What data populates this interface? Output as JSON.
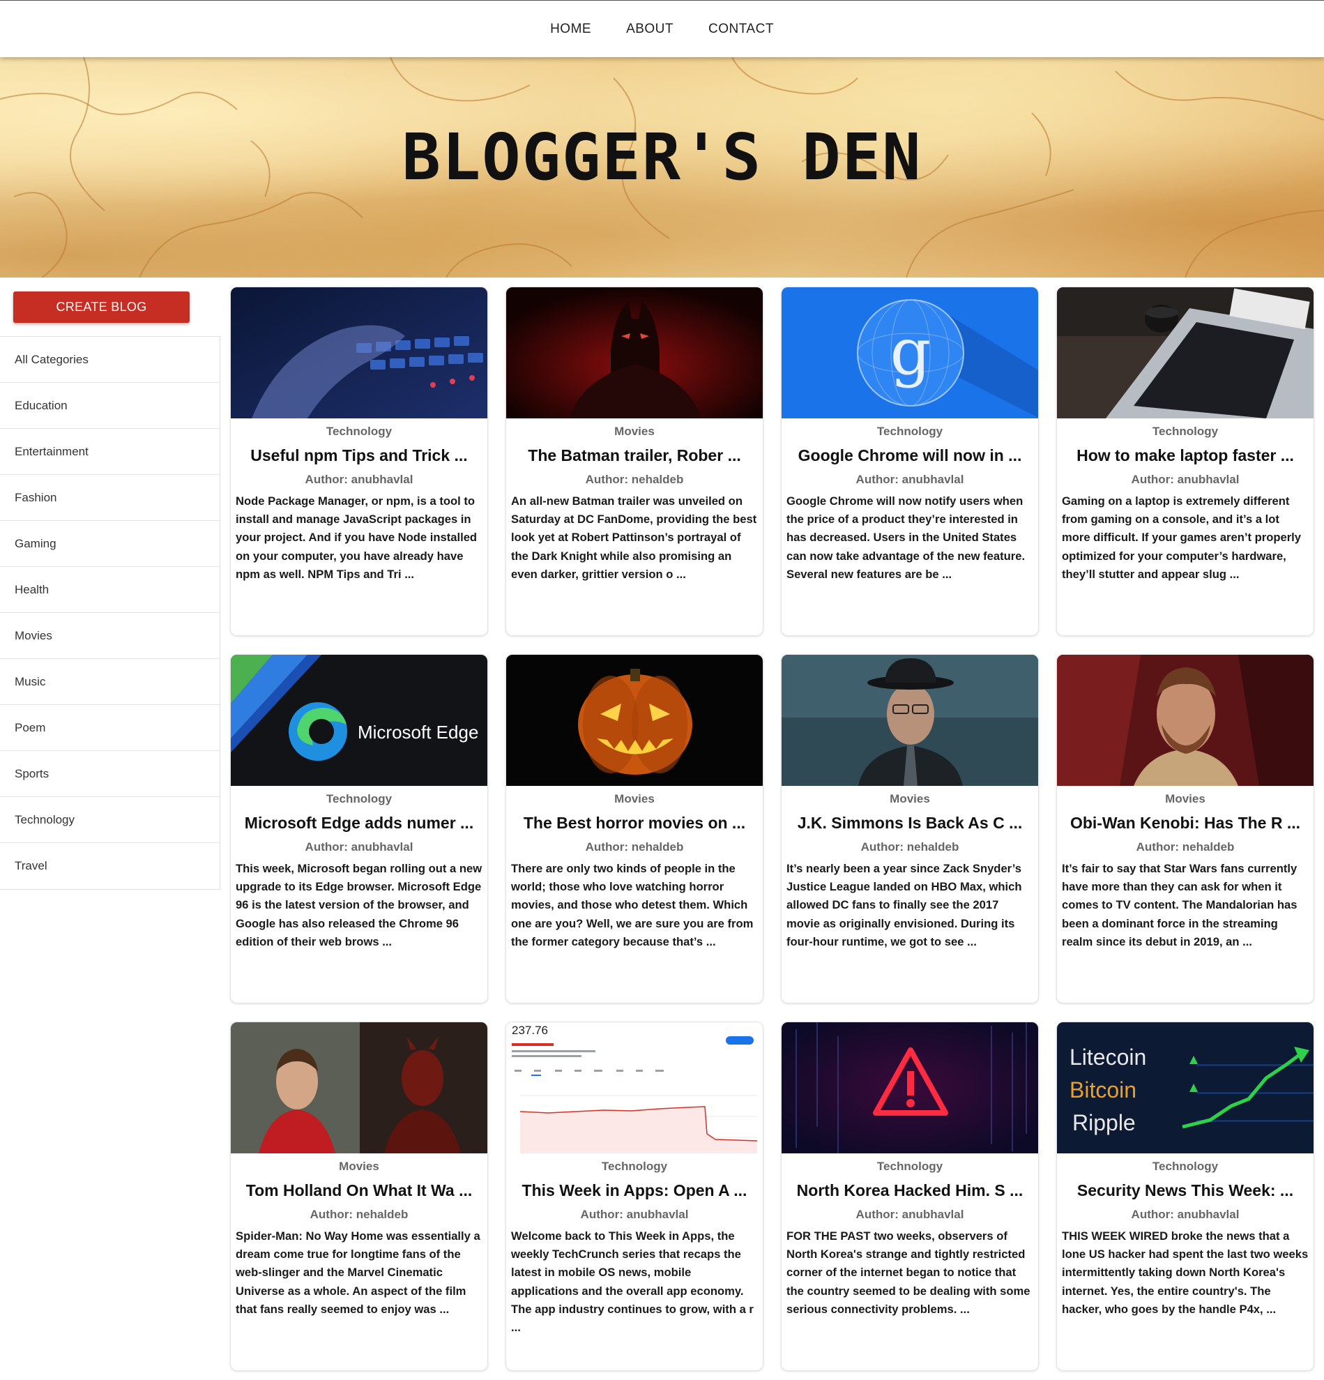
{
  "nav": {
    "links": [
      "HOME",
      "ABOUT",
      "CONTACT"
    ]
  },
  "hero": {
    "title": "BLOGGER'S DEN"
  },
  "sidebar": {
    "create_label": "CREATE BLOG",
    "categories": [
      "All Categories",
      "Education",
      "Entertainment",
      "Fashion",
      "Gaming",
      "Health",
      "Movies",
      "Music",
      "Poem",
      "Sports",
      "Technology",
      "Travel"
    ]
  },
  "posts": [
    {
      "category": "Technology",
      "title": "Useful npm Tips and Trick ...",
      "author": "Author: anubhavlal",
      "description": "Node Package Manager, or npm, is a tool to install and manage JavaScript packages in your project. And if you have Node installed on your computer, you have already have npm as well. NPM Tips and Tri ...",
      "image": "keyboard-hand"
    },
    {
      "category": "Movies",
      "title": "The Batman trailer, Rober ...",
      "author": "Author: nehaldeb",
      "description": "An all-new Batman trailer was unveiled on Saturday at DC FanDome, providing the best look yet at Robert Pattinson’s portrayal of the Dark Knight while also promising an even darker, grittier version o ...",
      "image": "batman"
    },
    {
      "category": "Technology",
      "title": "Google Chrome will now in ...",
      "author": "Author: anubhavlal",
      "description": "Google Chrome will now notify users when the price of a product they’re interested in has decreased. Users in the United States can now take advantage of the new feature. Several new features are be ...",
      "image": "google-globe"
    },
    {
      "category": "Technology",
      "title": "How to make laptop faster ...",
      "author": "Author: anubhavlal",
      "description": "Gaming on a laptop is extremely different from gaming on a console, and it’s a lot more difficult. If your games aren’t properly optimized for your computer’s hardware, they’ll stutter and appear slug ...",
      "image": "laptop"
    },
    {
      "category": "Technology",
      "title": "Microsoft Edge adds numer ...",
      "author": "Author: anubhavlal",
      "description": "This week, Microsoft began rolling out a new upgrade to its Edge browser. Microsoft Edge 96 is the latest version of the browser, and Google has also released the Chrome 96 edition of their web brows ...",
      "image": "edge-logo",
      "image_text": "Microsoft Edge"
    },
    {
      "category": "Movies",
      "title": "The Best horror movies on ...",
      "author": "Author: nehaldeb",
      "description": "There are only two kinds of people in the world; those who love watching horror movies, and those who detest them. Which one are you? Well, we are sure you are from the former category because that’s ...",
      "image": "pumpkin"
    },
    {
      "category": "Movies",
      "title": "J.K. Simmons Is Back As C ...",
      "author": "Author: nehaldeb",
      "description": "It’s nearly been a year since Zack Snyder’s Justice League landed on HBO Max, which allowed DC fans to finally see the 2017 movie as originally envisioned. During its four-hour runtime, we got to see ...",
      "image": "commissioner"
    },
    {
      "category": "Movies",
      "title": "Obi-Wan Kenobi: Has The R ...",
      "author": "Author: nehaldeb",
      "description": "It’s fair to say that Star Wars fans currently have more than they can ask for when it comes to TV content. The Mandalorian has been a dominant force in the streaming realm since its debut in 2019, an ...",
      "image": "obiwan"
    },
    {
      "category": "Movies",
      "title": "Tom Holland On What It Wa ...",
      "author": "Author: nehaldeb",
      "description": "Spider-Man: No Way Home was essentially a dream come true for longtime fans of the web-slinger and the Marvel Cinematic Universe as a whole. An aspect of the film that fans really seemed to enjoy was ...",
      "image": "spiderman-daredevil"
    },
    {
      "category": "Technology",
      "title": "This Week in Apps: Open A ...",
      "author": "Author: anubhavlal",
      "description": "Welcome back to This Week in Apps, the weekly TechCrunch series that recaps the latest in mobile OS news, mobile applications and the overall app economy. The app industry continues to grow, with a r ...",
      "image": "stock-chart",
      "image_text": "237.76"
    },
    {
      "category": "Technology",
      "title": "North Korea Hacked Him. S ...",
      "author": "Author: anubhavlal",
      "description": "FOR THE PAST two weeks, observers of North Korea's strange and tightly restricted corner of the internet began to notice that the country seemed to be dealing with some serious connectivity problems. ...",
      "image": "warning"
    },
    {
      "category": "Technology",
      "title": "Security News This Week: ...",
      "author": "Author: anubhavlal",
      "description": "THIS WEEK WIRED broke the news that a lone US hacker had spent the last two weeks intermittently taking down North Korea's internet. Yes, the entire country's. The hacker, who goes by the handle P4x, ...",
      "image": "crypto",
      "image_labels": [
        "Litecoin",
        "Bitcoin",
        "Ripple"
      ]
    }
  ],
  "colors": {
    "accent": "#c62d23"
  }
}
